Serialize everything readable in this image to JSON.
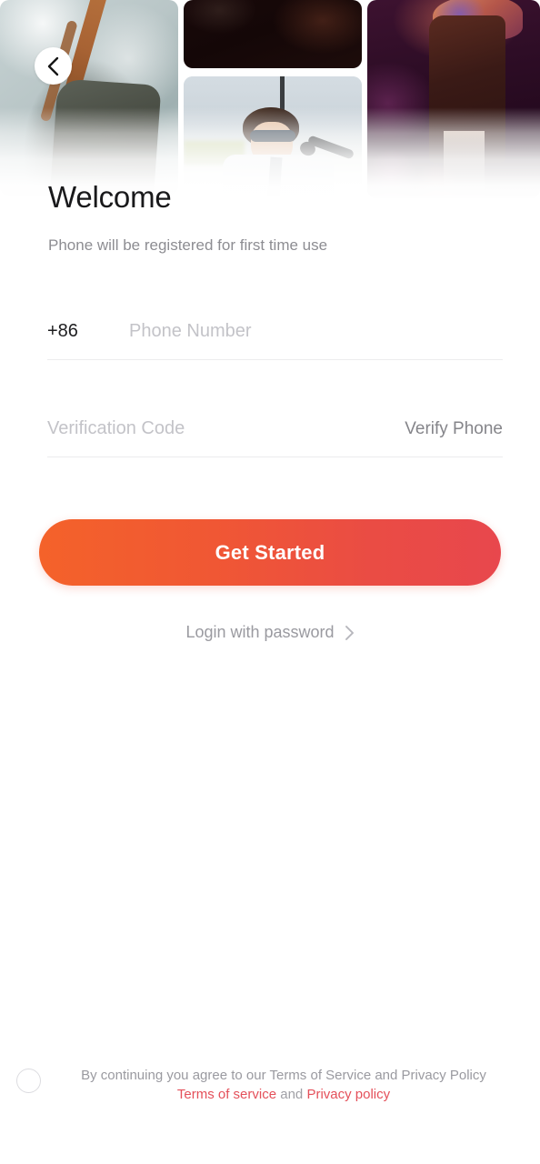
{
  "header": {
    "back_icon": "chevron-left-icon",
    "collage": [
      {
        "name": "performer-drummer-photo"
      },
      {
        "name": "dark-stage-photo"
      },
      {
        "name": "singer-sunglasses-photo"
      },
      {
        "name": "concert-stage-photo"
      }
    ]
  },
  "page": {
    "title": "Welcome",
    "subtitle": "Phone will be registered for first time use"
  },
  "form": {
    "country_code": "+86",
    "phone_placeholder": "Phone Number",
    "phone_value": "",
    "code_placeholder": "Verification Code",
    "code_value": "",
    "verify_label": "Verify Phone"
  },
  "actions": {
    "primary_label": "Get Started",
    "secondary_label": "Login with password",
    "secondary_icon": "chevron-right-icon"
  },
  "footer": {
    "agree_line1": "By continuing you agree to our Terms of Service and Privacy Policy",
    "terms_link": "Terms of service",
    "conjunction": "and",
    "privacy_link": "Privacy policy",
    "checkbox_checked": false
  },
  "colors": {
    "cta_gradient_start": "#f4622a",
    "cta_gradient_end": "#e8474d",
    "link_red": "#e4505a",
    "title": "#19191b",
    "muted": "#8d8d92",
    "placeholder": "#c3c3c8"
  }
}
